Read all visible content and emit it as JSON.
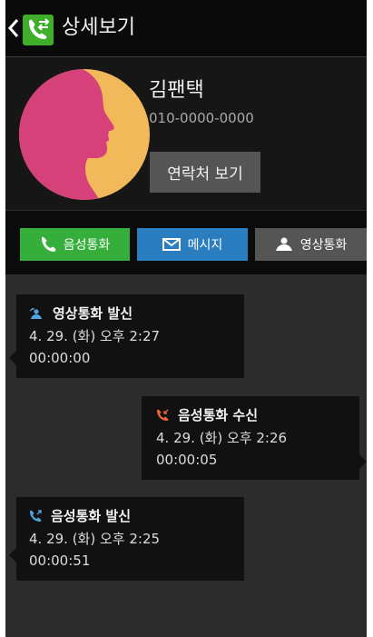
{
  "header": {
    "title": "상세보기"
  },
  "contact": {
    "name": "김팬택",
    "phone": "010-0000-0000",
    "view_contact_label": "연락처 보기"
  },
  "actions": {
    "voice_call": "음성통화",
    "message": "메시지",
    "video_call": "영상통화"
  },
  "colors": {
    "voice": "#36ae3b",
    "message": "#2a7ec0",
    "video": "#555555",
    "photo_bg": "#f2b95a",
    "photo_face": "#d7417a"
  },
  "call_log": [
    {
      "icon": "video-outgoing-icon",
      "type": "영상통화 발신",
      "datetime": "4. 29. (화) 오후 2:27",
      "duration": "00:00:00"
    },
    {
      "icon": "voice-incoming-icon",
      "type": "음성통화 수신",
      "datetime": "4. 29. (화) 오후 2:26",
      "duration": "00:00:05"
    },
    {
      "icon": "voice-outgoing-icon",
      "type": "음성통화 발신",
      "datetime": "4. 29. (화) 오후 2:25",
      "duration": "00:00:51"
    }
  ]
}
